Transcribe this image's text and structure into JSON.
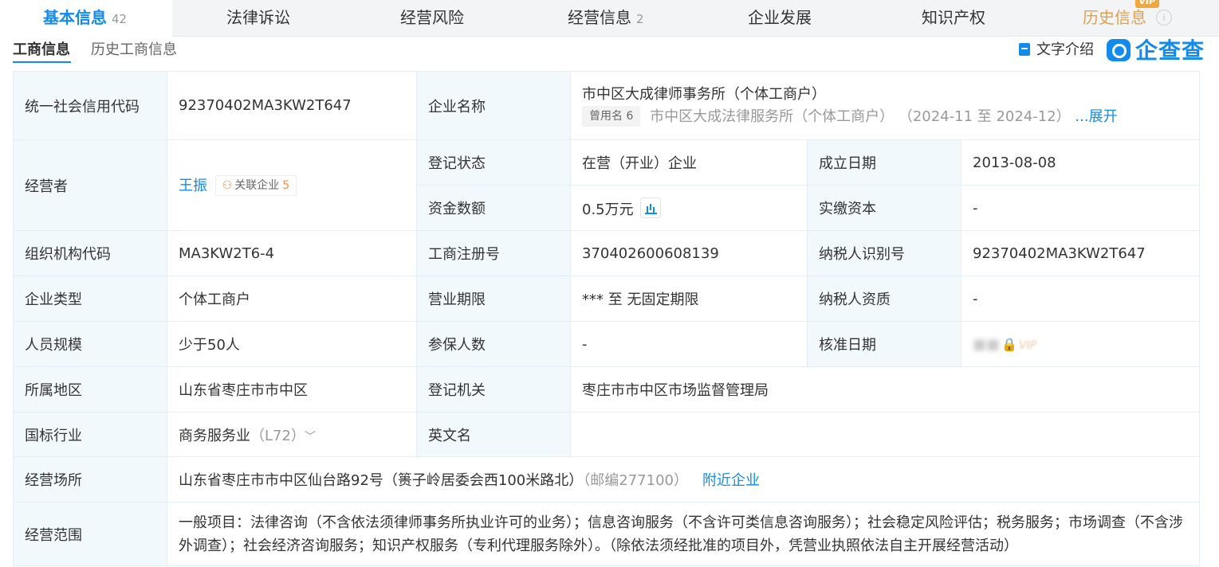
{
  "tabs": [
    {
      "label": "基本信息",
      "count": "42"
    },
    {
      "label": "法律诉讼",
      "count": ""
    },
    {
      "label": "经营风险",
      "count": ""
    },
    {
      "label": "经营信息",
      "count": "2"
    },
    {
      "label": "企业发展",
      "count": ""
    },
    {
      "label": "知识产权",
      "count": ""
    },
    {
      "label": "历史信息",
      "count": ""
    }
  ],
  "vip_badge": "VIP",
  "subtabs": {
    "current": "工商信息",
    "history": "历史工商信息"
  },
  "text_intro": "文字介绍",
  "logo_text": "企查查",
  "info": {
    "credit_code_label": "统一社会信用代码",
    "credit_code": "92370402MA3KW2T647",
    "company_name_label": "企业名称",
    "company_name": "市中区大成律师事务所（个体工商户）",
    "former_names_tag": "曾用名 6",
    "former_name": "市中区大成法律服务所（个体工商户）",
    "former_period": "（2024-11 至 2024-12）",
    "expand": "...展开",
    "operator_label": "经营者",
    "operator": "王振",
    "related_label": "关联企业",
    "related_count": "5",
    "status_label": "登记状态",
    "status": "在营（开业）企业",
    "founded_label": "成立日期",
    "founded": "2013-08-08",
    "funds_label": "资金数额",
    "funds": "0.5万元",
    "paid_label": "实缴资本",
    "paid": "-",
    "org_code_label": "组织机构代码",
    "org_code": "MA3KW2T6-4",
    "reg_no_label": "工商注册号",
    "reg_no": "370402600608139",
    "tax_id_label": "纳税人识别号",
    "tax_id": "92370402MA3KW2T647",
    "type_label": "企业类型",
    "type": "个体工商户",
    "term_label": "营业期限",
    "term": "*** 至 无固定期限",
    "taxpayer_label": "纳税人资质",
    "taxpayer": "-",
    "staff_label": "人员规模",
    "staff": "少于50人",
    "insured_label": "参保人数",
    "insured": "-",
    "approved_label": "核准日期",
    "approved_vip": "VIP",
    "region_label": "所属地区",
    "region": "山东省枣庄市市中区",
    "authority_label": "登记机关",
    "authority": "枣庄市市中区市场监督管理局",
    "industry_label": "国标行业",
    "industry": "商务服务业",
    "industry_code": "（L72）",
    "english_label": "英文名",
    "english": "",
    "address_label": "经营场所",
    "address": "山东省枣庄市市中区仙台路92号（篑子岭居委会西100米路北）",
    "postcode": "（邮编277100）",
    "nearby": "附近企业",
    "scope_label": "经营范围",
    "scope": "一般项目：法律咨询（不含依法须律师事务所执业许可的业务）；信息咨询服务（不含许可类信息咨询服务）；社会稳定风险评估；税务服务；市场调查（不含涉外调查）；社会经济咨询服务；知识产权服务（专利代理服务除外）。（除依法须经批准的项目外，凭营业执照依法自主开展经营活动）"
  },
  "colors": {
    "accent": "#128bed",
    "label_bg": "#f2f9fc",
    "orange": "#f38b4a"
  }
}
